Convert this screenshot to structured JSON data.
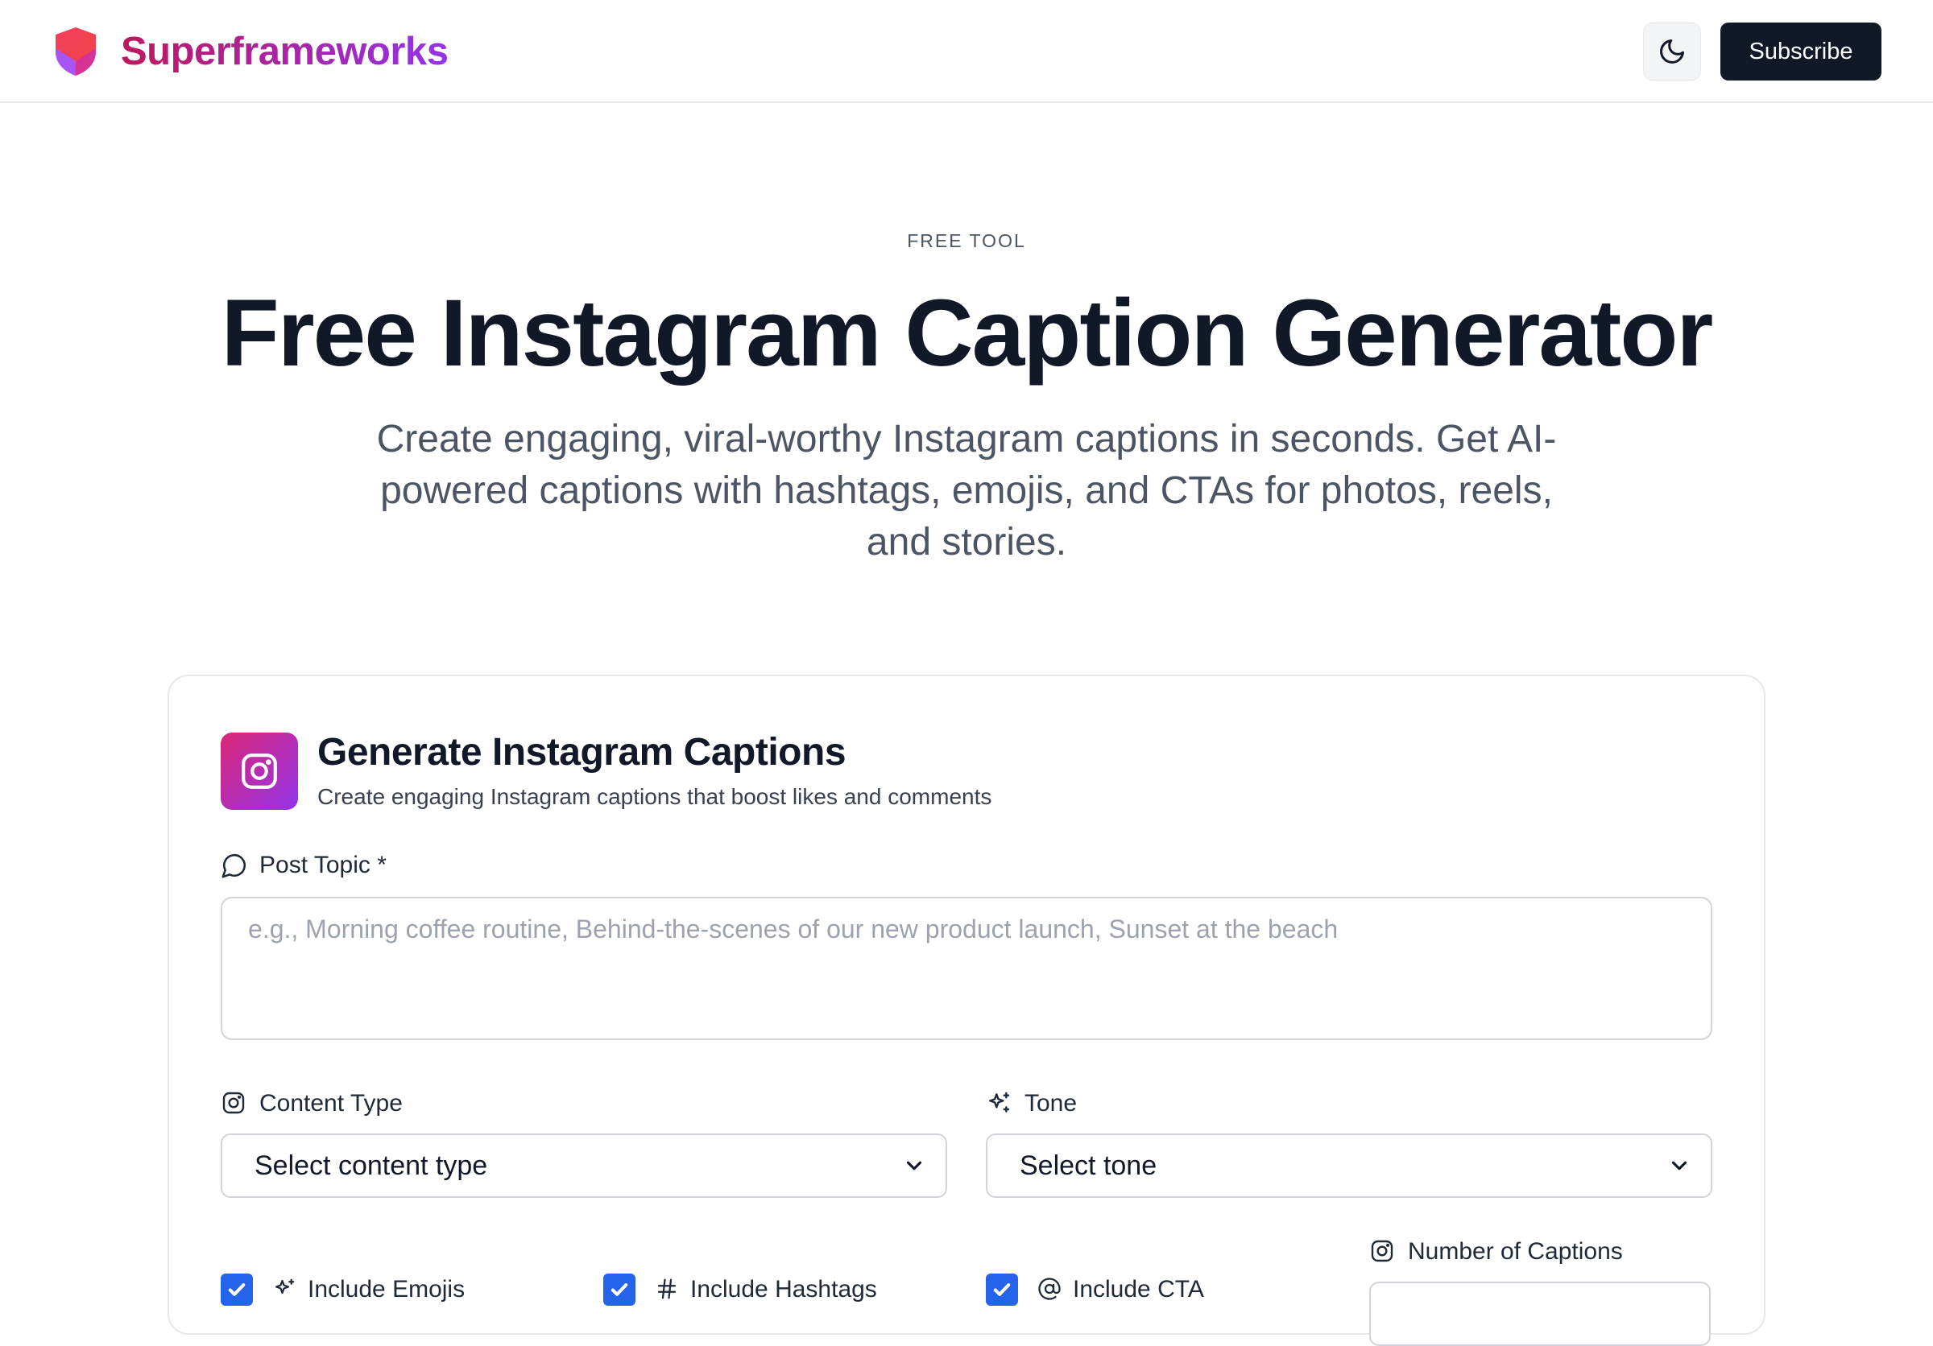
{
  "header": {
    "brand_name": "Superframeworks",
    "theme_toggle_icon": "moon-icon",
    "subscribe_label": "Subscribe",
    "brand_gradient": [
      "#be185d",
      "#9333ea"
    ]
  },
  "hero": {
    "eyebrow": "FREE TOOL",
    "title": "Free Instagram Caption Generator",
    "subtitle": "Create engaging, viral-worthy Instagram captions in seconds. Get AI-powered captions with hashtags, emojis, and CTAs for photos, reels, and stories."
  },
  "card": {
    "icon": "instagram-icon",
    "title": "Generate Instagram Captions",
    "subtitle": "Create engaging Instagram captions that boost likes and comments",
    "post_topic": {
      "label": "Post Topic *",
      "icon": "message-circle-icon",
      "placeholder": "e.g., Morning coffee routine, Behind-the-scenes of our new product launch, Sunset at the beach",
      "value": ""
    },
    "content_type": {
      "label": "Content Type",
      "icon": "instagram-icon",
      "selected": "Select content type"
    },
    "tone": {
      "label": "Tone",
      "icon": "sparkles-icon",
      "selected": "Select tone"
    },
    "options": [
      {
        "label": "Include Emojis",
        "icon": "sparkles-icon",
        "checked": true
      },
      {
        "label": "Include Hashtags",
        "icon": "hash-icon",
        "checked": true
      },
      {
        "label": "Include CTA",
        "icon": "at-sign-icon",
        "checked": true
      }
    ],
    "number_of_captions": {
      "label": "Number of Captions",
      "icon": "instagram-icon"
    }
  },
  "colors": {
    "primary_dark": "#111827",
    "checkbox_blue": "#2563eb",
    "instagram_gradient": [
      "#db2777",
      "#9333ea"
    ],
    "border": "#e5e7eb"
  }
}
